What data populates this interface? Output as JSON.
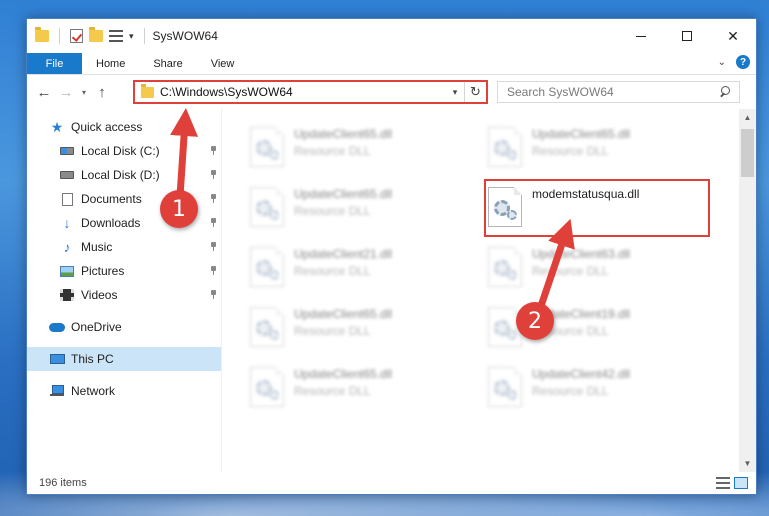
{
  "window": {
    "title": "SysWOW64",
    "controls": {
      "minimize": "",
      "maximize": "",
      "close": "✕"
    }
  },
  "ribbon": {
    "file_tab": "File",
    "tabs": [
      "Home",
      "Share",
      "View"
    ]
  },
  "navigation": {
    "back": "←",
    "forward": "→",
    "recent": "▾",
    "up": "↑",
    "address": "C:\\Windows\\SysWOW64",
    "refresh": "↻",
    "search_placeholder": "Search SysWOW64"
  },
  "sidebar": {
    "quick_access": "Quick access",
    "pinned": [
      "Local Disk (C:)",
      "Local Disk (D:)",
      "Documents",
      "Downloads",
      "Music",
      "Pictures",
      "Videos"
    ],
    "onedrive": "OneDrive",
    "this_pc": "This PC",
    "network": "Network"
  },
  "files": [
    {
      "name": "UpdateClient65.dll",
      "type": "Resource DLL"
    },
    {
      "name": "UpdateClient65.dll",
      "type": "Resource DLL"
    },
    {
      "name": "UpdateClient65.dll",
      "type": "Resource DLL"
    },
    {
      "name": "modemstatusqua.dll",
      "type": ""
    },
    {
      "name": "UpdateClient21.dll",
      "type": "Resource DLL"
    },
    {
      "name": "UpdateClient63.dll",
      "type": "Resource DLL"
    },
    {
      "name": "UpdateClient65.dll",
      "type": "Resource DLL"
    },
    {
      "name": "UpdateClient19.dll",
      "type": "Resource DLL"
    },
    {
      "name": "UpdateClient65.dll",
      "type": "Resource DLL"
    },
    {
      "name": "UpdateClient42.dll",
      "type": "Resource DLL"
    }
  ],
  "status": {
    "item_count": "196 items"
  },
  "annotations": {
    "step1": "1",
    "step2": "2",
    "accent": "#e0403a"
  }
}
